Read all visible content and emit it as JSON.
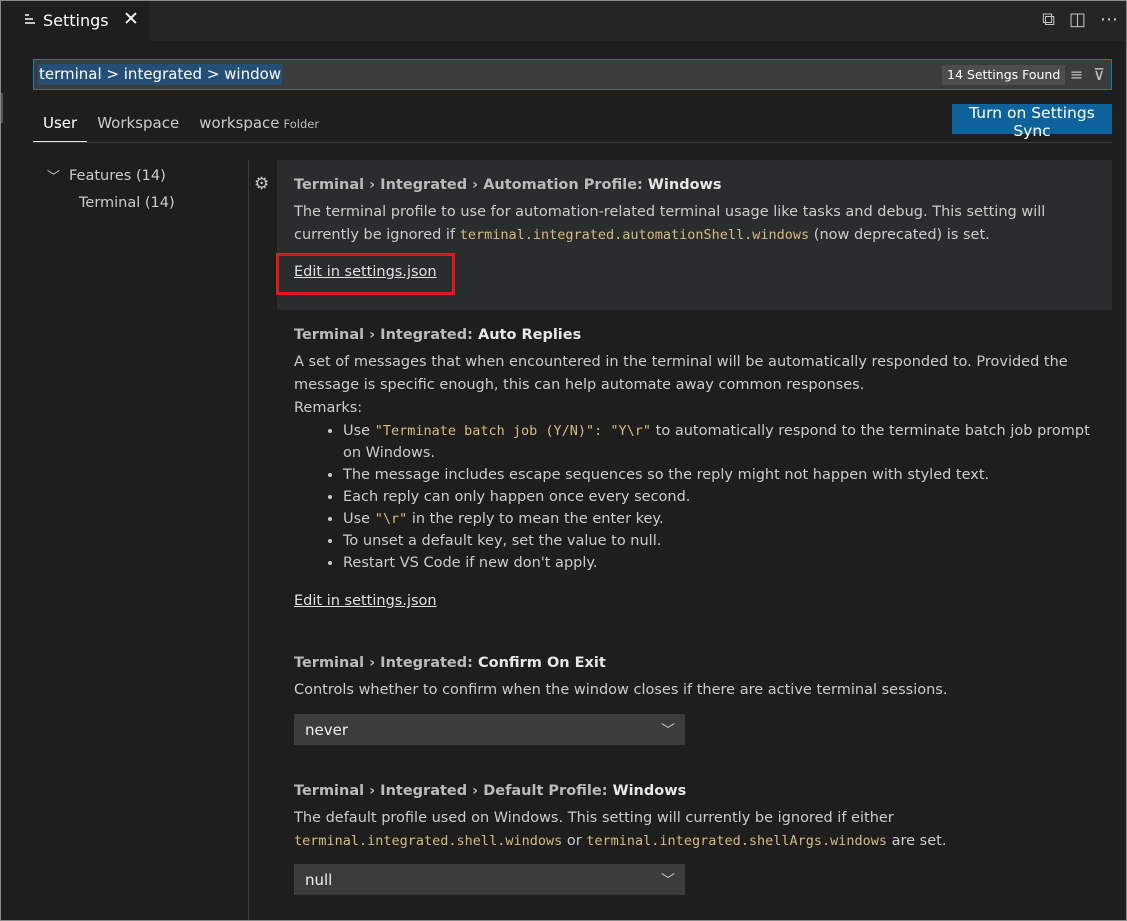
{
  "tab": {
    "label": "Settings",
    "close": "✕"
  },
  "title_actions": {
    "open_json": "⧉",
    "split": "◫",
    "more": "⋯"
  },
  "search": {
    "value": "terminal > integrated > window",
    "found": "14 Settings Found",
    "clear_icon": "≡",
    "filter_icon": "⊽"
  },
  "scopes": [
    {
      "label": "User"
    },
    {
      "label": "Workspace"
    },
    {
      "label": "workspace",
      "hint": "Folder"
    }
  ],
  "sync_button": "Turn on Settings Sync",
  "tree": {
    "parent": "Features (14)",
    "child": "Terminal (14)"
  },
  "settings": [
    {
      "category": "Terminal › Integrated › Automation Profile: ",
      "key": "Windows",
      "desc_1": "The terminal profile to use for automation-related terminal usage like tasks and debug. This setting will currently be ignored if ",
      "code_1": "terminal.integrated.automationShell.windows",
      "desc_2": " (now deprecated) is set.",
      "link": "Edit in settings.json"
    },
    {
      "category": "Terminal › Integrated: ",
      "key": "Auto Replies",
      "desc": "A set of messages that when encountered in the terminal will be automatically responded to. Provided the message is specific enough, this can help automate away common responses.",
      "remarks_label": "Remarks:",
      "r1_pre": "Use ",
      "r1_code": "\"Terminate batch job (Y/N)\": \"Y\\r\"",
      "r1_post": " to automatically respond to the terminate batch job prompt on Windows.",
      "r2": "The message includes escape sequences so the reply might not happen with styled text.",
      "r3": "Each reply can only happen once every second.",
      "r4_pre": "Use ",
      "r4_code": "\"\\r\"",
      "r4_post": " in the reply to mean the enter key.",
      "r5": "To unset a default key, set the value to null.",
      "r6": "Restart VS Code if new don't apply.",
      "link": "Edit in settings.json"
    },
    {
      "category": "Terminal › Integrated: ",
      "key": "Confirm On Exit",
      "desc": "Controls whether to confirm when the window closes if there are active terminal sessions.",
      "value": "never"
    },
    {
      "category": "Terminal › Integrated › Default Profile: ",
      "key": "Windows",
      "desc_1": "The default profile used on Windows. This setting will currently be ignored if either ",
      "code_1": "terminal.integrated.shell.windows",
      "desc_2": " or ",
      "code_2": "terminal.integrated.shellArgs.windows",
      "desc_3": " are set.",
      "value": "null"
    }
  ],
  "colors": {
    "accent": "#007fd4",
    "button": "#0e639c",
    "highlight": "#e5161b",
    "code": "#d7ba7d"
  }
}
